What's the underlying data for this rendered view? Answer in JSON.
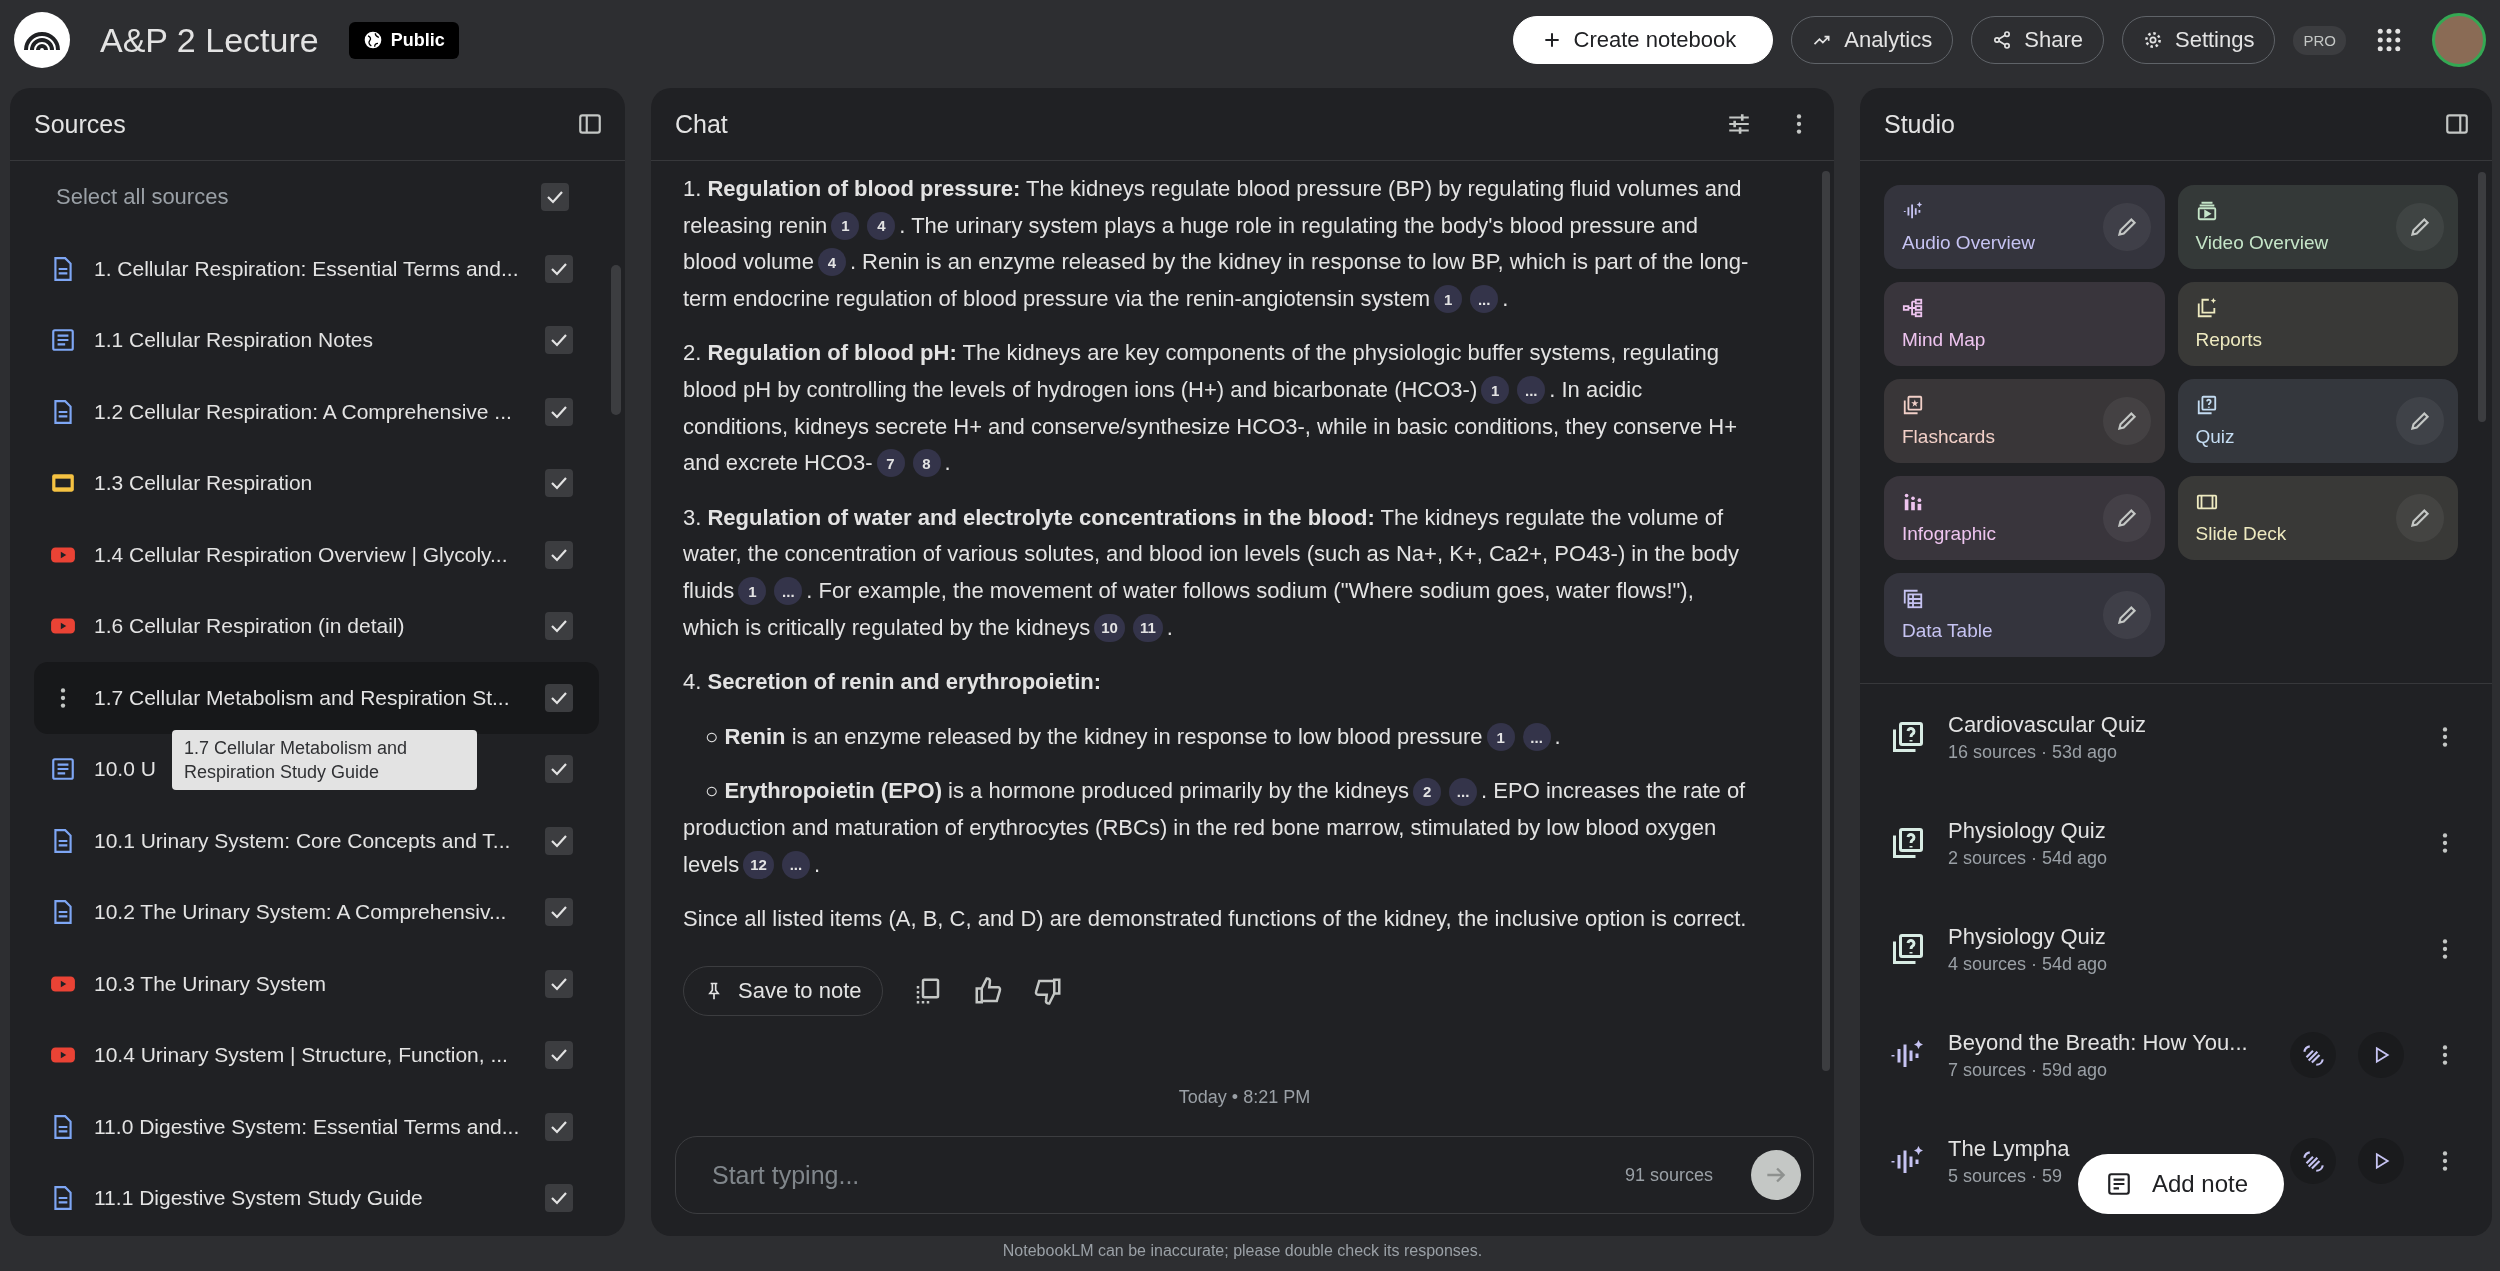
{
  "app": {
    "title": "A&P 2 Lecture",
    "visibility": "Public",
    "plan_badge": "PRO"
  },
  "toolbar": [
    {
      "kind": "create",
      "label": "Create notebook"
    },
    {
      "kind": "analytics",
      "label": "Analytics"
    },
    {
      "kind": "share",
      "label": "Share"
    },
    {
      "kind": "settings",
      "label": "Settings"
    }
  ],
  "sources": {
    "title": "Sources",
    "select_all": {
      "label": "Select all sources",
      "checked": true
    },
    "items": [
      {
        "kind": "doc",
        "title": "1. Cellular Respiration: Essential Terms and...",
        "checked": true,
        "highlighted": false
      },
      {
        "kind": "text",
        "title": "1.1 Cellular Respiration Notes",
        "checked": true,
        "highlighted": false
      },
      {
        "kind": "doc",
        "title": "1.2 Cellular Respiration: A Comprehensive ...",
        "checked": true,
        "highlighted": false
      },
      {
        "kind": "slides",
        "title": "1.3 Cellular Respiration",
        "checked": true,
        "highlighted": false
      },
      {
        "kind": "video",
        "title": "1.4 Cellular Respiration Overview | Glycoly...",
        "checked": true,
        "highlighted": false
      },
      {
        "kind": "video",
        "title": "1.6 Cellular Respiration (in detail)",
        "checked": true,
        "highlighted": false
      },
      {
        "title": "1.7 Cellular Metabolism and Respiration St...",
        "checked": true,
        "highlighted": true,
        "tooltip": "1.7 Cellular Metabolism and Respiration Study Guide"
      },
      {
        "kind": "text",
        "title": "10.0 U",
        "checked": true,
        "highlighted": false
      },
      {
        "kind": "doc",
        "title": "10.1 Urinary System: Core Concepts and T...",
        "checked": true,
        "highlighted": false
      },
      {
        "kind": "doc",
        "title": "10.2 The Urinary System: A Comprehensiv...",
        "checked": true,
        "highlighted": false
      },
      {
        "kind": "video",
        "title": "10.3 The Urinary System",
        "checked": true,
        "highlighted": false
      },
      {
        "kind": "video",
        "title": "10.4 Urinary System | Structure, Function, ...",
        "checked": true,
        "highlighted": false
      },
      {
        "kind": "doc",
        "title": "11.0 Digestive System: Essential Terms and...",
        "checked": true,
        "highlighted": false
      },
      {
        "kind": "doc",
        "title": "11.1 Digestive System Study Guide",
        "checked": true,
        "highlighted": false
      }
    ]
  },
  "chat": {
    "title": "Chat",
    "paragraphs": [
      {
        "kind": "para",
        "lines": [
          [
            {
              "kind": "text",
              "text": "1. **Regulation of blood pressure:** The kidneys regulate blood pressure (BP) by regulating fluid volumes and"
            }
          ],
          [
            {
              "kind": "text",
              "text": "releasing renin"
            },
            {
              "kind": "cite",
              "text": "1"
            },
            {
              "kind": "cite",
              "text": "4"
            },
            {
              "kind": "text",
              "text": ". The urinary system plays a huge role in regulating the body's blood pressure and"
            }
          ],
          [
            {
              "kind": "text",
              "text": "blood volume"
            },
            {
              "kind": "cite",
              "text": "4"
            },
            {
              "kind": "text",
              "text": ". Renin is an enzyme released by the kidney in response to low BP, which is part of the long-"
            }
          ],
          [
            {
              "kind": "text",
              "text": "term endocrine regulation of blood pressure via the renin-angiotensin system"
            },
            {
              "kind": "cite",
              "text": "1"
            },
            {
              "kind": "cite",
              "text": "..."
            },
            {
              "kind": "text",
              "text": "."
            }
          ]
        ]
      },
      {
        "kind": "para",
        "lines": [
          [
            {
              "kind": "text",
              "text": "2. **Regulation of blood pH:** The kidneys are key components of the physiologic buffer systems, regulating"
            }
          ],
          [
            {
              "kind": "text",
              "text": "blood pH by controlling the levels of hydrogen ions (H+) and bicarbonate (HCO3-)"
            },
            {
              "kind": "cite",
              "text": "1"
            },
            {
              "kind": "cite",
              "text": "..."
            },
            {
              "kind": "text",
              "text": ". In acidic"
            }
          ],
          [
            {
              "kind": "text",
              "text": "conditions, kidneys secrete H+ and conserve/synthesize HCO3-, while in basic conditions, they conserve H+"
            }
          ],
          [
            {
              "kind": "text",
              "text": "and excrete HCO3-"
            },
            {
              "kind": "cite",
              "text": "7"
            },
            {
              "kind": "cite",
              "text": "8"
            },
            {
              "kind": "text",
              "text": "."
            }
          ]
        ]
      },
      {
        "kind": "para",
        "lines": [
          [
            {
              "kind": "text",
              "text": "3. **Regulation of water and electrolyte concentrations in the blood:** The kidneys regulate the volume of"
            }
          ],
          [
            {
              "kind": "text",
              "text": "water, the concentration of various solutes, and blood ion levels (such as Na+, K+, Ca2+, PO43-) in the body"
            }
          ],
          [
            {
              "kind": "text",
              "text": "fluids"
            },
            {
              "kind": "cite",
              "text": "1"
            },
            {
              "kind": "cite",
              "text": "..."
            },
            {
              "kind": "text",
              "text": ". For example, the movement of water follows sodium (\"Where sodium goes, water flows!\"),"
            }
          ],
          [
            {
              "kind": "text",
              "text": "which is critically regulated by the kidneys"
            },
            {
              "kind": "cite",
              "text": "10"
            },
            {
              "kind": "cite",
              "text": "11"
            },
            {
              "kind": "text",
              "text": "."
            }
          ]
        ]
      },
      {
        "kind": "para",
        "lines": [
          [
            {
              "kind": "text",
              "text": "4. **Secretion of renin and erythropoietin:**"
            }
          ]
        ]
      },
      {
        "kind": "bullet",
        "lines": [
          [
            {
              "kind": "text",
              "text": "○ **Renin** is an enzyme released by the kidney in response to low blood pressure"
            },
            {
              "kind": "cite",
              "text": "1"
            },
            {
              "kind": "cite",
              "text": "..."
            },
            {
              "kind": "text",
              "text": "."
            }
          ]
        ]
      },
      {
        "kind": "bullet",
        "lines": [
          [
            {
              "kind": "text",
              "text": "○ **Erythropoietin (EPO)** is a hormone produced primarily by the kidneys"
            },
            {
              "kind": "cite",
              "text": "2"
            },
            {
              "kind": "cite",
              "text": "..."
            },
            {
              "kind": "text",
              "text": ". EPO increases the rate of"
            }
          ],
          [
            {
              "kind": "text",
              "text": "production and maturation of erythrocytes (RBCs) in the red bone marrow, stimulated by low blood oxygen"
            }
          ],
          [
            {
              "kind": "text",
              "text": "levels"
            },
            {
              "kind": "cite",
              "text": "12"
            },
            {
              "kind": "cite",
              "text": "..."
            },
            {
              "kind": "text",
              "text": "."
            }
          ]
        ]
      },
      {
        "kind": "para",
        "lines": [
          [
            {
              "kind": "text",
              "text": "Since all listed items (A, B, C, and D) are demonstrated functions of the kidney, the inclusive option is correct."
            }
          ]
        ]
      }
    ],
    "save_label": "Save to note",
    "timestamp": "Today • 8:21 PM",
    "input": {
      "placeholder": "Start typing...",
      "source_count": "91 sources"
    },
    "disclaimer": "NotebookLM can be inaccurate; please double check its responses."
  },
  "studio": {
    "title": "Studio",
    "tiles": [
      {
        "kind": "audio",
        "label": "Audio Overview",
        "color": "#c6c3f2",
        "editable": true
      },
      {
        "kind": "video",
        "label": "Video Overview",
        "color": "#c5e5c8",
        "editable": true
      },
      {
        "kind": "mindmap",
        "label": "Mind Map",
        "color": "#eec4ef",
        "editable": false
      },
      {
        "kind": "reports",
        "label": "Reports",
        "color": "#eeeac0",
        "editable": false
      },
      {
        "kind": "flashcards",
        "label": "Flashcards",
        "color": "#f2d0c8",
        "editable": true
      },
      {
        "kind": "quiz",
        "label": "Quiz",
        "color": "#c4dcf2",
        "editable": true
      },
      {
        "kind": "infographic",
        "label": "Infographic",
        "color": "#eec4ef",
        "editable": true
      },
      {
        "kind": "slides",
        "label": "Slide Deck",
        "color": "#eeeac0",
        "editable": true
      },
      {
        "kind": "table",
        "label": "Data Table",
        "color": "#c6c3f2",
        "editable": true
      }
    ],
    "notes": [
      {
        "kind": "quiz",
        "title": "Cardiovascular Quiz",
        "meta": "16 sources · 53d ago"
      },
      {
        "kind": "quiz",
        "title": "Physiology Quiz",
        "meta": "2 sources · 54d ago"
      },
      {
        "kind": "quiz",
        "title": "Physiology Quiz",
        "meta": "4 sources · 54d ago"
      },
      {
        "kind": "audio",
        "title": "Beyond the Breath: How You...",
        "meta": "7 sources · 59d ago"
      },
      {
        "kind": "audio",
        "title": "The Lympha",
        "meta": "5 sources · 59"
      }
    ],
    "add_note": "Add note"
  }
}
